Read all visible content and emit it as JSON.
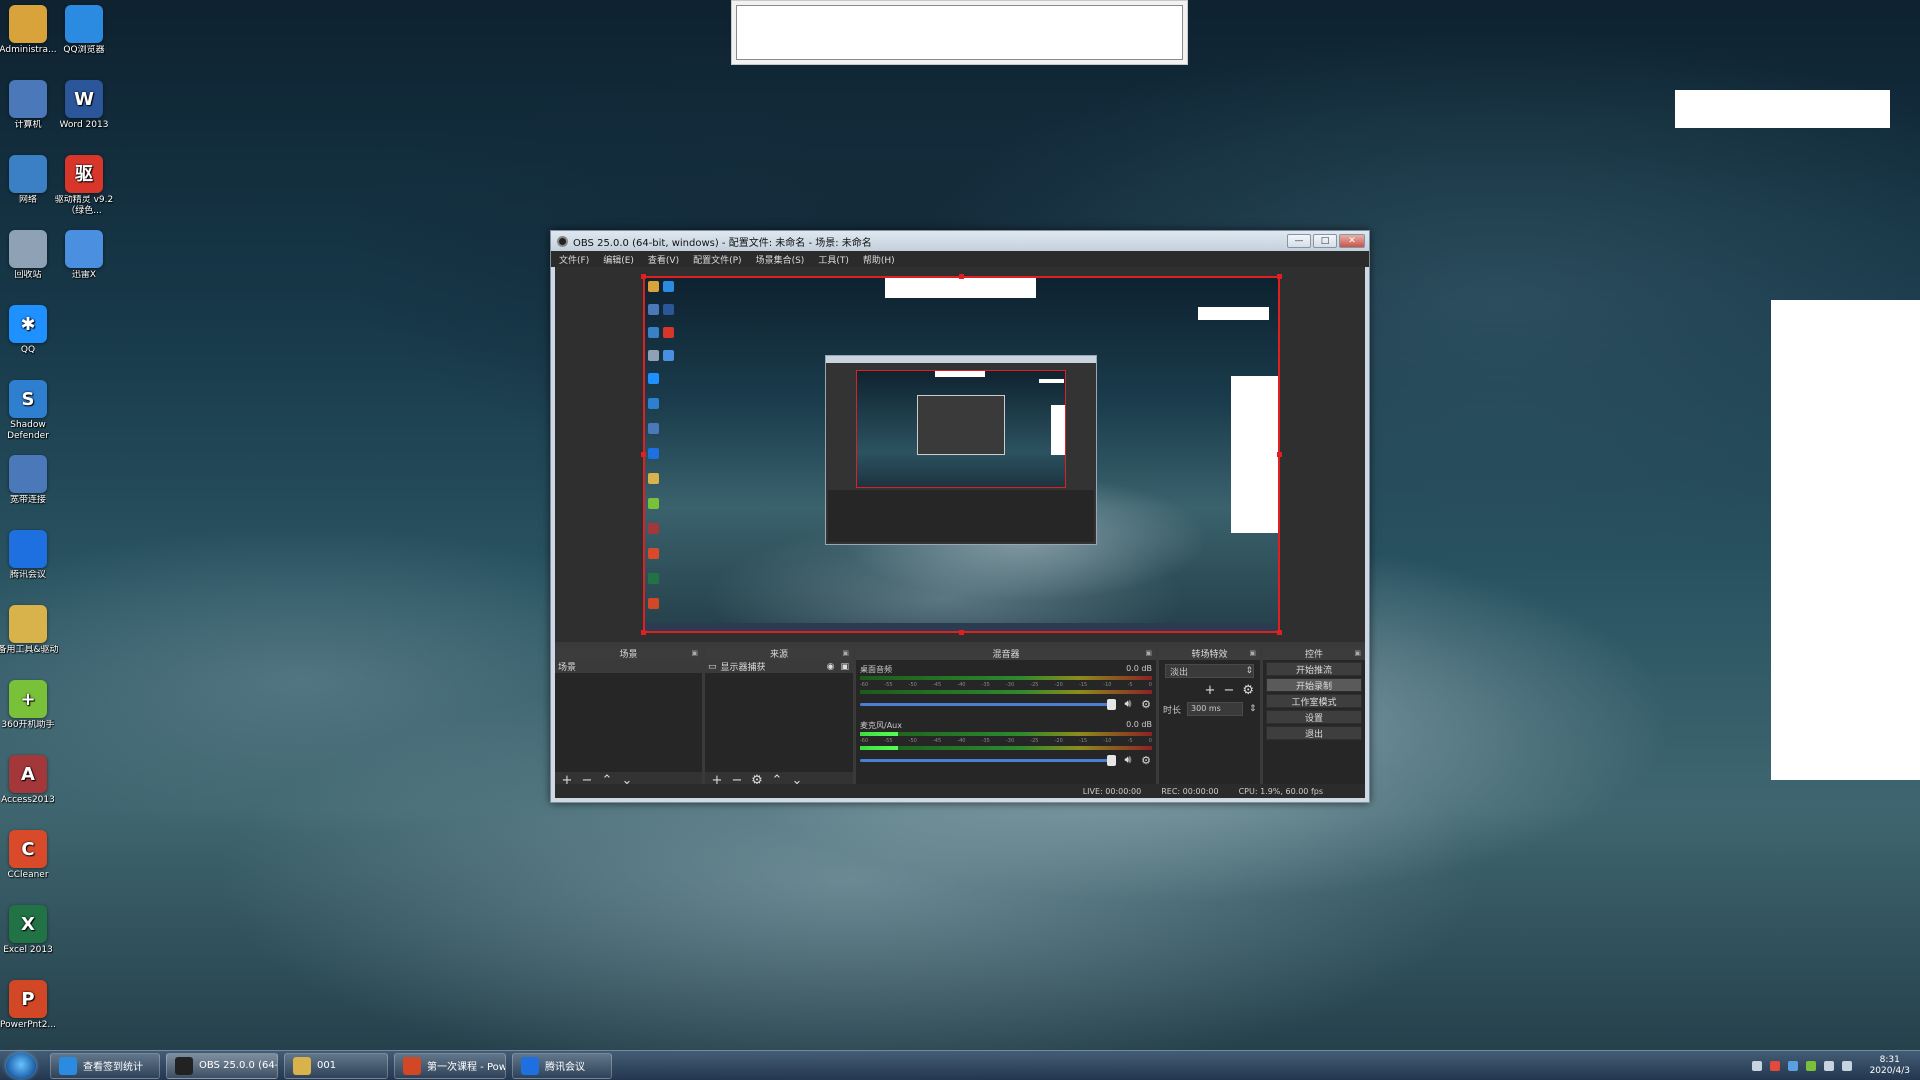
{
  "desktop_icons": [
    {
      "label": "Administra...",
      "icon": "folder-user-icon",
      "color": "#d8a33a"
    },
    {
      "label": "QQ浏览器",
      "icon": "qq-browser-icon",
      "color": "#2a8be0"
    },
    {
      "label": "计算机",
      "icon": "computer-icon",
      "color": "#4a78b8"
    },
    {
      "label": "Word 2013",
      "icon": "word-icon",
      "color": "#2b579a",
      "glyph": "W"
    },
    {
      "label": "网络",
      "icon": "network-icon",
      "color": "#3b7fc4"
    },
    {
      "label": "驱动精灵 v9.2（绿色...",
      "icon": "driver-genius-icon",
      "color": "#d9362b",
      "glyph": "驱"
    },
    {
      "label": "回收站",
      "icon": "recycle-bin-icon",
      "color": "#8fa2b5"
    },
    {
      "label": "迅雷X",
      "icon": "thunder-icon",
      "color": "#4a8fe0"
    },
    {
      "label": "QQ",
      "icon": "qq-icon",
      "color": "#1e90ff",
      "glyph": "✱"
    },
    {
      "label": "Shadow Defender",
      "icon": "shadow-defender-icon",
      "color": "#2f7fd0",
      "glyph": "S"
    },
    {
      "label": "宽带连接",
      "icon": "broadband-icon",
      "color": "#4a78b8"
    },
    {
      "label": "腾讯会议",
      "icon": "tencent-meeting-icon",
      "color": "#1e6fe0"
    },
    {
      "label": "备用工具&驱动",
      "icon": "folder-icon",
      "color": "#d8b24a"
    },
    {
      "label": "360开机助手",
      "icon": "360-boot-icon",
      "color": "#7ac13a",
      "glyph": "+"
    },
    {
      "label": "Access2013",
      "icon": "access-icon",
      "color": "#a4373a",
      "glyph": "A"
    },
    {
      "label": "CCleaner",
      "icon": "ccleaner-icon",
      "color": "#d94a2b",
      "glyph": "C"
    },
    {
      "label": "Excel 2013",
      "icon": "excel-icon",
      "color": "#217346",
      "glyph": "X"
    },
    {
      "label": "PowerPnt2...",
      "icon": "powerpoint-icon",
      "color": "#d24726",
      "glyph": "P"
    }
  ],
  "obs": {
    "title": "OBS 25.0.0 (64-bit, windows) - 配置文件: 未命名 - 场景: 未命名",
    "window_buttons": {
      "minimize": "—",
      "maximize": "□",
      "close": "✕"
    },
    "menu": [
      "文件(F)",
      "编辑(E)",
      "查看(V)",
      "配置文件(P)",
      "场景集合(S)",
      "工具(T)",
      "帮助(H)"
    ],
    "docks": {
      "scenes": {
        "title": "场景",
        "items": [
          "场景"
        ]
      },
      "sources": {
        "title": "来源",
        "items": [
          "显示器捕获"
        ]
      },
      "mixer": {
        "title": "混音器",
        "channels": [
          {
            "name": "桌面音频",
            "db": "0.0 dB",
            "level": 0.0
          },
          {
            "name": "麦克风/Aux",
            "db": "0.0 dB",
            "level": 0.13
          }
        ],
        "scale": [
          "-60",
          "-55",
          "-50",
          "-45",
          "-40",
          "-35",
          "-30",
          "-25",
          "-20",
          "-15",
          "-10",
          "-5",
          "0"
        ]
      },
      "transitions": {
        "title": "转场特效",
        "selected": "淡出",
        "duration_label": "时长",
        "duration_value": "300 ms"
      },
      "controls": {
        "title": "控件",
        "buttons": [
          "开始推流",
          "开始录制",
          "工作室模式",
          "设置",
          "退出"
        ]
      }
    },
    "status": {
      "live": "LIVE: 00:00:00",
      "rec": "REC: 00:00:00",
      "cpu": "CPU: 1.9%, 60.00 fps"
    }
  },
  "taskbar": {
    "items": [
      {
        "label": "查看签到统计",
        "icon": "qq-browser-icon",
        "color": "#2a8be0"
      },
      {
        "label": "OBS 25.0.0 (64-bit...",
        "icon": "obs-icon",
        "color": "#222222"
      },
      {
        "label": "001",
        "icon": "folder-icon",
        "color": "#d8b24a"
      },
      {
        "label": "第一次课程 - Pow...",
        "icon": "powerpoint-icon",
        "color": "#d24726"
      },
      {
        "label": "腾讯会议",
        "icon": "tencent-meeting-icon",
        "color": "#1e6fe0"
      }
    ],
    "time": "8:31",
    "date": "2020/4/3"
  }
}
